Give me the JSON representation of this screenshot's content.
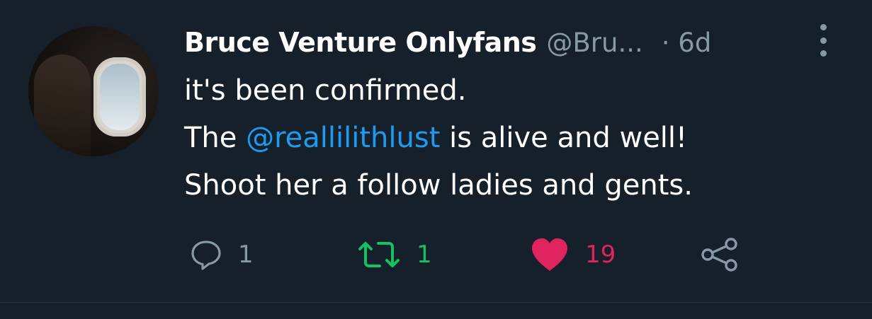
{
  "tweet": {
    "author_name": "Bruce Venture Onlyfans",
    "handle": "@Bru...",
    "time": "· 6d",
    "lines": {
      "line1": "it's been confirmed.",
      "line2_prefix": "The ",
      "line2_mention": "@reallilithlust",
      "line2_suffix": " is alive and well!",
      "line3": "Shoot her a follow ladies and gents."
    },
    "actions": {
      "reply_count": "1",
      "retweet_count": "1",
      "like_count": "19"
    }
  },
  "icons": {
    "reply": "reply-icon",
    "retweet": "retweet-icon",
    "like": "heart-icon",
    "share": "share-icon",
    "more": "more-vertical-icon"
  },
  "colors": {
    "background": "#15202b",
    "secondary_text": "#8899a6",
    "mention": "#1d9bf0",
    "retweet_active": "#17bf63",
    "like_active": "#e0245e"
  }
}
